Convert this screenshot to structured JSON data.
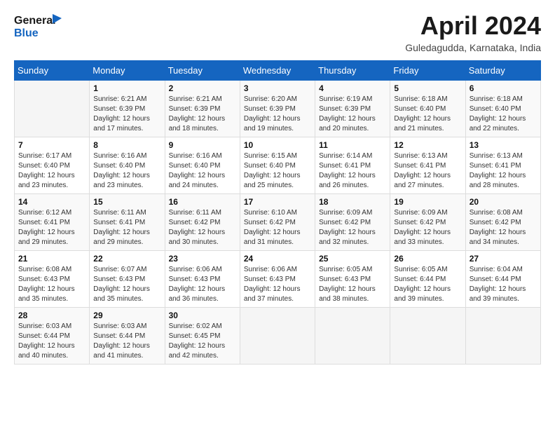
{
  "header": {
    "logo_line1": "General",
    "logo_line2": "Blue",
    "title": "April 2024",
    "subtitle": "Guledagudda, Karnataka, India"
  },
  "calendar": {
    "weekdays": [
      "Sunday",
      "Monday",
      "Tuesday",
      "Wednesday",
      "Thursday",
      "Friday",
      "Saturday"
    ],
    "weeks": [
      [
        {
          "day": "",
          "info": ""
        },
        {
          "day": "1",
          "info": "Sunrise: 6:21 AM\nSunset: 6:39 PM\nDaylight: 12 hours\nand 17 minutes."
        },
        {
          "day": "2",
          "info": "Sunrise: 6:21 AM\nSunset: 6:39 PM\nDaylight: 12 hours\nand 18 minutes."
        },
        {
          "day": "3",
          "info": "Sunrise: 6:20 AM\nSunset: 6:39 PM\nDaylight: 12 hours\nand 19 minutes."
        },
        {
          "day": "4",
          "info": "Sunrise: 6:19 AM\nSunset: 6:39 PM\nDaylight: 12 hours\nand 20 minutes."
        },
        {
          "day": "5",
          "info": "Sunrise: 6:18 AM\nSunset: 6:40 PM\nDaylight: 12 hours\nand 21 minutes."
        },
        {
          "day": "6",
          "info": "Sunrise: 6:18 AM\nSunset: 6:40 PM\nDaylight: 12 hours\nand 22 minutes."
        }
      ],
      [
        {
          "day": "7",
          "info": "Sunrise: 6:17 AM\nSunset: 6:40 PM\nDaylight: 12 hours\nand 23 minutes."
        },
        {
          "day": "8",
          "info": "Sunrise: 6:16 AM\nSunset: 6:40 PM\nDaylight: 12 hours\nand 23 minutes."
        },
        {
          "day": "9",
          "info": "Sunrise: 6:16 AM\nSunset: 6:40 PM\nDaylight: 12 hours\nand 24 minutes."
        },
        {
          "day": "10",
          "info": "Sunrise: 6:15 AM\nSunset: 6:40 PM\nDaylight: 12 hours\nand 25 minutes."
        },
        {
          "day": "11",
          "info": "Sunrise: 6:14 AM\nSunset: 6:41 PM\nDaylight: 12 hours\nand 26 minutes."
        },
        {
          "day": "12",
          "info": "Sunrise: 6:13 AM\nSunset: 6:41 PM\nDaylight: 12 hours\nand 27 minutes."
        },
        {
          "day": "13",
          "info": "Sunrise: 6:13 AM\nSunset: 6:41 PM\nDaylight: 12 hours\nand 28 minutes."
        }
      ],
      [
        {
          "day": "14",
          "info": "Sunrise: 6:12 AM\nSunset: 6:41 PM\nDaylight: 12 hours\nand 29 minutes."
        },
        {
          "day": "15",
          "info": "Sunrise: 6:11 AM\nSunset: 6:41 PM\nDaylight: 12 hours\nand 29 minutes."
        },
        {
          "day": "16",
          "info": "Sunrise: 6:11 AM\nSunset: 6:42 PM\nDaylight: 12 hours\nand 30 minutes."
        },
        {
          "day": "17",
          "info": "Sunrise: 6:10 AM\nSunset: 6:42 PM\nDaylight: 12 hours\nand 31 minutes."
        },
        {
          "day": "18",
          "info": "Sunrise: 6:09 AM\nSunset: 6:42 PM\nDaylight: 12 hours\nand 32 minutes."
        },
        {
          "day": "19",
          "info": "Sunrise: 6:09 AM\nSunset: 6:42 PM\nDaylight: 12 hours\nand 33 minutes."
        },
        {
          "day": "20",
          "info": "Sunrise: 6:08 AM\nSunset: 6:42 PM\nDaylight: 12 hours\nand 34 minutes."
        }
      ],
      [
        {
          "day": "21",
          "info": "Sunrise: 6:08 AM\nSunset: 6:43 PM\nDaylight: 12 hours\nand 35 minutes."
        },
        {
          "day": "22",
          "info": "Sunrise: 6:07 AM\nSunset: 6:43 PM\nDaylight: 12 hours\nand 35 minutes."
        },
        {
          "day": "23",
          "info": "Sunrise: 6:06 AM\nSunset: 6:43 PM\nDaylight: 12 hours\nand 36 minutes."
        },
        {
          "day": "24",
          "info": "Sunrise: 6:06 AM\nSunset: 6:43 PM\nDaylight: 12 hours\nand 37 minutes."
        },
        {
          "day": "25",
          "info": "Sunrise: 6:05 AM\nSunset: 6:43 PM\nDaylight: 12 hours\nand 38 minutes."
        },
        {
          "day": "26",
          "info": "Sunrise: 6:05 AM\nSunset: 6:44 PM\nDaylight: 12 hours\nand 39 minutes."
        },
        {
          "day": "27",
          "info": "Sunrise: 6:04 AM\nSunset: 6:44 PM\nDaylight: 12 hours\nand 39 minutes."
        }
      ],
      [
        {
          "day": "28",
          "info": "Sunrise: 6:03 AM\nSunset: 6:44 PM\nDaylight: 12 hours\nand 40 minutes."
        },
        {
          "day": "29",
          "info": "Sunrise: 6:03 AM\nSunset: 6:44 PM\nDaylight: 12 hours\nand 41 minutes."
        },
        {
          "day": "30",
          "info": "Sunrise: 6:02 AM\nSunset: 6:45 PM\nDaylight: 12 hours\nand 42 minutes."
        },
        {
          "day": "",
          "info": ""
        },
        {
          "day": "",
          "info": ""
        },
        {
          "day": "",
          "info": ""
        },
        {
          "day": "",
          "info": ""
        }
      ]
    ]
  }
}
